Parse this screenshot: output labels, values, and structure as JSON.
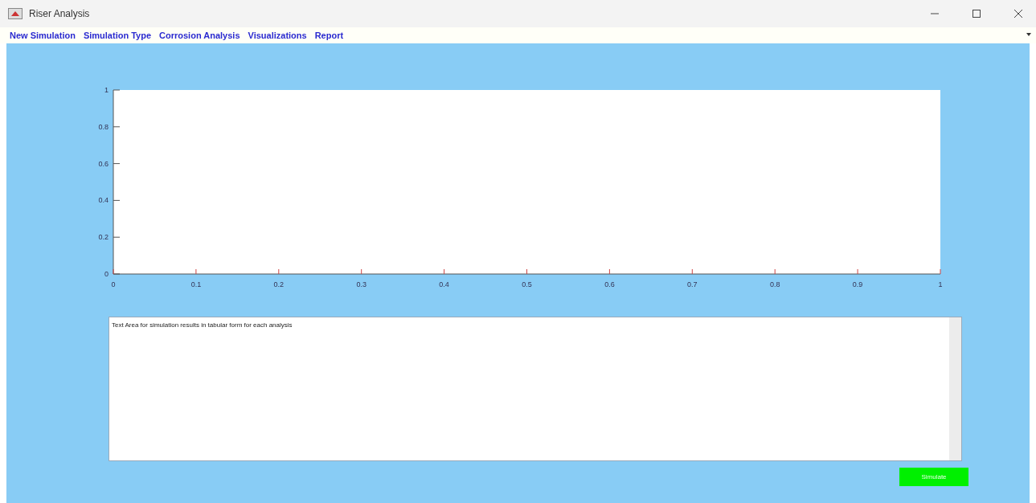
{
  "window": {
    "title": "Riser Analysis"
  },
  "menu": [
    "New Simulation",
    "Simulation Type",
    "Corrosion Analysis",
    "Visualizations",
    "Report"
  ],
  "axes": {
    "chart_data": {
      "type": "line",
      "xlim": [
        0,
        1
      ],
      "ylim": [
        0,
        1
      ],
      "xticks": [
        {
          "value": 0,
          "label": "0"
        },
        {
          "value": 0.1,
          "label": "0.1"
        },
        {
          "value": 0.2,
          "label": "0.2"
        },
        {
          "value": 0.3,
          "label": "0.3"
        },
        {
          "value": 0.4,
          "label": "0.4"
        },
        {
          "value": 0.5,
          "label": "0.5"
        },
        {
          "value": 0.6,
          "label": "0.6"
        },
        {
          "value": 0.7,
          "label": "0.7"
        },
        {
          "value": 0.8,
          "label": "0.8"
        },
        {
          "value": 0.9,
          "label": "0.9"
        },
        {
          "value": 1,
          "label": "1"
        }
      ],
      "yticks": [
        {
          "value": 0,
          "label": "0"
        },
        {
          "value": 0.2,
          "label": "0.2"
        },
        {
          "value": 0.4,
          "label": "0.4"
        },
        {
          "value": 0.6,
          "label": "0.6"
        },
        {
          "value": 0.8,
          "label": "0.8"
        },
        {
          "value": 1,
          "label": "1"
        }
      ]
    }
  },
  "results": {
    "value": "Text Area for simulation results in tabular form for each analysis"
  },
  "buttons": [
    {
      "label": "Simulate"
    }
  ]
}
